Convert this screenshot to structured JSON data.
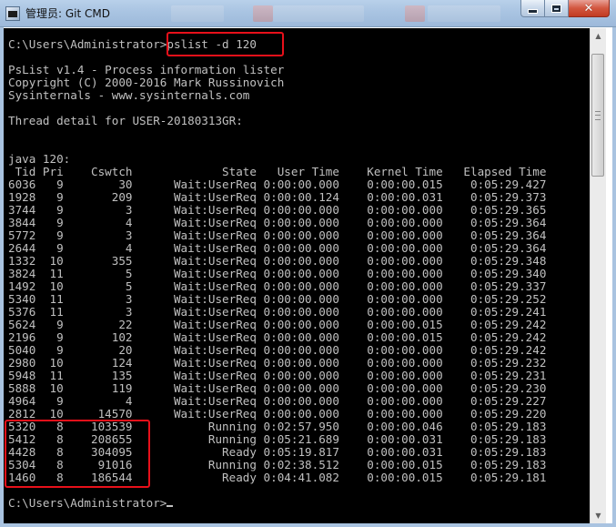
{
  "window": {
    "title": "管理员: Git CMD",
    "close_glyph": "✕"
  },
  "console": {
    "prompt_line": "C:\\Users\\Administrator>pslist -d 120",
    "banner": [
      "PsList v1.4 - Process information lister",
      "Copyright (C) 2000-2016 Mark Russinovich",
      "Sysinternals - www.sysinternals.com"
    ],
    "thread_detail_line": "Thread detail for USER-20180313GR:",
    "process_line": "java 120:",
    "table": {
      "columns": [
        "Tid",
        "Pri",
        "Cswtch",
        "State",
        "User Time",
        "Kernel Time",
        "Elapsed Time"
      ],
      "rows": [
        [
          "6036",
          "9",
          "30",
          "Wait:UserReq",
          "0:00:00.000",
          "0:00:00.015",
          "0:05:29.427"
        ],
        [
          "1928",
          "9",
          "209",
          "Wait:UserReq",
          "0:00:00.124",
          "0:00:00.031",
          "0:05:29.373"
        ],
        [
          "3744",
          "9",
          "3",
          "Wait:UserReq",
          "0:00:00.000",
          "0:00:00.000",
          "0:05:29.365"
        ],
        [
          "3844",
          "9",
          "4",
          "Wait:UserReq",
          "0:00:00.000",
          "0:00:00.000",
          "0:05:29.364"
        ],
        [
          "5772",
          "9",
          "3",
          "Wait:UserReq",
          "0:00:00.000",
          "0:00:00.000",
          "0:05:29.364"
        ],
        [
          "2644",
          "9",
          "4",
          "Wait:UserReq",
          "0:00:00.000",
          "0:00:00.000",
          "0:05:29.364"
        ],
        [
          "1332",
          "10",
          "355",
          "Wait:UserReq",
          "0:00:00.000",
          "0:00:00.000",
          "0:05:29.348"
        ],
        [
          "3824",
          "11",
          "5",
          "Wait:UserReq",
          "0:00:00.000",
          "0:00:00.000",
          "0:05:29.340"
        ],
        [
          "1492",
          "10",
          "5",
          "Wait:UserReq",
          "0:00:00.000",
          "0:00:00.000",
          "0:05:29.337"
        ],
        [
          "5340",
          "11",
          "3",
          "Wait:UserReq",
          "0:00:00.000",
          "0:00:00.000",
          "0:05:29.252"
        ],
        [
          "5376",
          "11",
          "3",
          "Wait:UserReq",
          "0:00:00.000",
          "0:00:00.000",
          "0:05:29.241"
        ],
        [
          "5624",
          "9",
          "22",
          "Wait:UserReq",
          "0:00:00.000",
          "0:00:00.015",
          "0:05:29.242"
        ],
        [
          "2196",
          "9",
          "102",
          "Wait:UserReq",
          "0:00:00.000",
          "0:00:00.015",
          "0:05:29.242"
        ],
        [
          "5040",
          "9",
          "20",
          "Wait:UserReq",
          "0:00:00.000",
          "0:00:00.000",
          "0:05:29.242"
        ],
        [
          "2980",
          "10",
          "124",
          "Wait:UserReq",
          "0:00:00.000",
          "0:00:00.000",
          "0:05:29.232"
        ],
        [
          "5948",
          "11",
          "135",
          "Wait:UserReq",
          "0:00:00.000",
          "0:00:00.000",
          "0:05:29.231"
        ],
        [
          "5888",
          "10",
          "119",
          "Wait:UserReq",
          "0:00:00.000",
          "0:00:00.000",
          "0:05:29.230"
        ],
        [
          "4964",
          "9",
          "4",
          "Wait:UserReq",
          "0:00:00.000",
          "0:00:00.000",
          "0:05:29.227"
        ],
        [
          "2812",
          "10",
          "14570",
          "Wait:UserReq",
          "0:00:00.000",
          "0:00:00.000",
          "0:05:29.220"
        ],
        [
          "5320",
          "8",
          "103539",
          "Running",
          "0:02:57.950",
          "0:00:00.046",
          "0:05:29.183"
        ],
        [
          "5412",
          "8",
          "208655",
          "Running",
          "0:05:21.689",
          "0:00:00.031",
          "0:05:29.183"
        ],
        [
          "4428",
          "8",
          "304095",
          "Ready",
          "0:05:19.817",
          "0:00:00.031",
          "0:05:29.183"
        ],
        [
          "5304",
          "8",
          "91016",
          "Running",
          "0:02:38.512",
          "0:00:00.015",
          "0:05:29.183"
        ],
        [
          "1460",
          "8",
          "186544",
          "Ready",
          "0:04:41.082",
          "0:00:00.015",
          "0:05:29.181"
        ]
      ]
    },
    "final_prompt": "C:\\Users\\Administrator>"
  },
  "colors": {
    "console_bg": "#000000",
    "console_fg": "#c0c0c0",
    "highlight": "#e8101a",
    "titlebar": "#a9c4e2"
  },
  "icons": {
    "app": "cmd-app-icon",
    "minimize": "minimize-icon",
    "maximize": "maximize-icon",
    "close": "close-icon",
    "scroll_up": "scroll-up-arrow-icon",
    "scroll_down": "scroll-down-arrow-icon"
  }
}
